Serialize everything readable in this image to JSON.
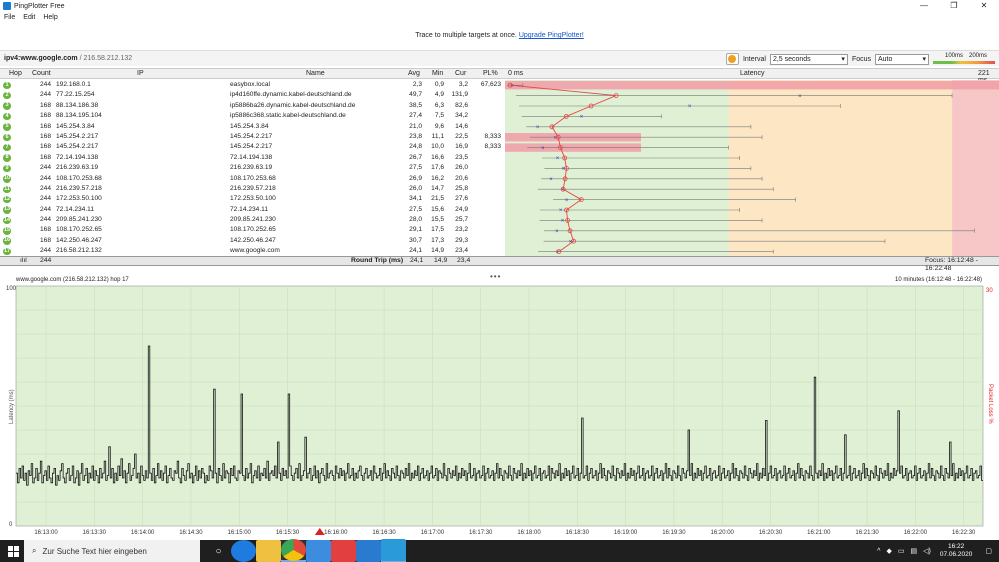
{
  "window": {
    "title": "PingPlotter Free",
    "minimize": "—",
    "maximize": "❐",
    "close": "✕"
  },
  "menu": [
    "File",
    "Edit",
    "Help"
  ],
  "banner": {
    "text": "Trace to multiple targets at once.",
    "link": "Upgrade PingPlotter!"
  },
  "target": {
    "prefix": "ipv4:",
    "host": "www.google.com",
    "ip": "/ 216.58.212.132"
  },
  "toolbar": {
    "interval_label": "Interval",
    "interval_value": "2,5 seconds",
    "focus_label": "Focus",
    "focus_value": "Auto",
    "scale_100": "100ms",
    "scale_200": "200ms"
  },
  "columns": {
    "hop": "Hop",
    "count": "Count",
    "ip": "IP",
    "name": "Name",
    "avg": "Avg",
    "min": "Min",
    "cur": "Cur",
    "pl": "PL%",
    "zero": "0 ms",
    "latency": "Latency",
    "max": "221 ms"
  },
  "hops": [
    {
      "hop": "1",
      "count": "244",
      "ip": "192.168.0.1",
      "name": "easybox.local",
      "avg": "2,3",
      "min": "0,9",
      "cur": "3,2",
      "pl": "67,623"
    },
    {
      "hop": "2",
      "count": "244",
      "ip": "77.22.15.254",
      "name": "ip4d160ffe.dynamic.kabel-deutschland.de",
      "avg": "49,7",
      "min": "4,9",
      "cur": "131,9",
      "pl": ""
    },
    {
      "hop": "3",
      "count": "168",
      "ip": "88.134.186.38",
      "name": "ip5886ba26.dynamic.kabel-deutschland.de",
      "avg": "38,5",
      "min": "6,3",
      "cur": "82,6",
      "pl": ""
    },
    {
      "hop": "4",
      "count": "168",
      "ip": "88.134.195.104",
      "name": "ip5886c368.static.kabel-deutschland.de",
      "avg": "27,4",
      "min": "7,5",
      "cur": "34,2",
      "pl": ""
    },
    {
      "hop": "5",
      "count": "168",
      "ip": "145.254.3.84",
      "name": "145.254.3.84",
      "avg": "21,0",
      "min": "9,6",
      "cur": "14,6",
      "pl": ""
    },
    {
      "hop": "6",
      "count": "168",
      "ip": "145.254.2.217",
      "name": "145.254.2.217",
      "avg": "23,8",
      "min": "11,1",
      "cur": "22,5",
      "pl": "8,333"
    },
    {
      "hop": "7",
      "count": "168",
      "ip": "145.254.2.217",
      "name": "145.254.2.217",
      "avg": "24,8",
      "min": "10,0",
      "cur": "16,9",
      "pl": "8,333"
    },
    {
      "hop": "8",
      "count": "168",
      "ip": "72.14.194.138",
      "name": "72.14.194.138",
      "avg": "26,7",
      "min": "16,6",
      "cur": "23,5",
      "pl": ""
    },
    {
      "hop": "9",
      "count": "244",
      "ip": "216.239.63.19",
      "name": "216.239.63.19",
      "avg": "27,5",
      "min": "17,6",
      "cur": "26,0",
      "pl": ""
    },
    {
      "hop": "10",
      "count": "244",
      "ip": "108.170.253.68",
      "name": "108.170.253.68",
      "avg": "26,9",
      "min": "16,2",
      "cur": "20,6",
      "pl": ""
    },
    {
      "hop": "11",
      "count": "244",
      "ip": "216.239.57.218",
      "name": "216.239.57.218",
      "avg": "26,0",
      "min": "14,7",
      "cur": "25,8",
      "pl": ""
    },
    {
      "hop": "12",
      "count": "244",
      "ip": "172.253.50.100",
      "name": "172.253.50.100",
      "avg": "34,1",
      "min": "21,5",
      "cur": "27,6",
      "pl": ""
    },
    {
      "hop": "13",
      "count": "244",
      "ip": "72.14.234.11",
      "name": "72.14.234.11",
      "avg": "27,5",
      "min": "15,6",
      "cur": "24,9",
      "pl": ""
    },
    {
      "hop": "14",
      "count": "244",
      "ip": "209.85.241.230",
      "name": "209.85.241.230",
      "avg": "28,0",
      "min": "15,5",
      "cur": "25,7",
      "pl": ""
    },
    {
      "hop": "15",
      "count": "168",
      "ip": "108.170.252.65",
      "name": "108.170.252.65",
      "avg": "29,1",
      "min": "17,5",
      "cur": "23,2",
      "pl": ""
    },
    {
      "hop": "16",
      "count": "168",
      "ip": "142.250.46.247",
      "name": "142.250.46.247",
      "avg": "30,7",
      "min": "17,3",
      "cur": "29,3",
      "pl": ""
    },
    {
      "hop": "17",
      "count": "244",
      "ip": "216.58.212.132",
      "name": "www.google.com",
      "avg": "24,1",
      "min": "14,9",
      "cur": "23,4",
      "pl": ""
    }
  ],
  "summary": {
    "count": "244",
    "label": "Round Trip (ms)",
    "avg": "24,1",
    "min": "14,9",
    "cur": "23,4",
    "focus": "Focus: 16:12:48 - 16:22:48"
  },
  "graph": {
    "title": "www.google.com (216.58.212.132) hop 17",
    "range": "10 minutes (16:12:48 - 16:22:48)",
    "ylabel": "Latency (ms)",
    "y2label": "Packet Loss %",
    "y_top": "100",
    "y_bottom": "0",
    "y2_top": "30",
    "xticks": [
      "16:13:00",
      "16:13:30",
      "16:14:00",
      "16:14:30",
      "16:15:00",
      "16:15:30",
      "16:16:00",
      "16:16:30",
      "16:17:00",
      "16:17:30",
      "16:18:00",
      "16:18:30",
      "16:19:00",
      "16:19:30",
      "16:20:00",
      "16:20:30",
      "16:21:00",
      "16:21:30",
      "16:22:00",
      "16:22:30"
    ]
  },
  "chart_data": {
    "type": "line",
    "title": "www.google.com (216.58.212.132) hop 17",
    "ylabel": "Latency (ms)",
    "ylim": [
      0,
      100
    ],
    "x_range": [
      "16:12:48",
      "16:22:48"
    ],
    "series": [
      {
        "values": [
          22,
          18,
          24,
          20,
          25,
          19,
          22,
          17,
          23,
          21,
          26,
          18,
          20,
          24,
          19,
          22,
          27,
          18,
          21,
          23,
          19,
          25,
          20,
          18,
          22,
          24,
          17,
          21,
          19,
          23,
          26,
          20,
          18,
          22,
          24,
          19,
          21,
          25,
          18,
          20,
          23,
          17,
          22,
          26,
          19,
          21,
          24,
          18,
          22,
          20,
          25,
          19,
          23,
          21,
          18,
          24,
          20,
          22,
          27,
          19,
          21,
          33,
          20,
          24,
          18,
          22,
          19,
          25,
          21,
          28,
          20,
          23,
          18,
          22,
          26,
          19,
          21,
          24,
          30,
          20,
          22,
          18,
          25,
          21,
          19,
          23,
          20,
          75,
          22,
          19,
          24,
          18,
          21,
          26,
          20,
          23,
          19,
          22,
          25,
          18,
          21,
          24,
          20,
          19,
          23,
          22,
          27,
          20,
          18,
          24,
          21,
          19,
          23,
          26,
          20,
          22,
          18,
          21,
          25,
          19,
          23,
          20,
          24,
          22,
          18,
          21,
          19,
          25,
          23,
          20,
          57,
          22,
          18,
          24,
          21,
          19,
          26,
          20,
          23,
          22,
          18,
          24,
          21,
          25,
          20,
          19,
          23,
          22,
          55,
          21,
          19,
          24,
          20,
          22,
          26,
          18,
          21,
          23,
          20,
          25,
          19,
          22,
          21,
          24,
          20,
          27,
          19,
          22,
          23,
          21,
          25,
          20,
          35,
          22,
          19,
          24,
          21,
          23,
          20,
          55,
          25,
          21,
          19,
          22,
          24,
          20,
          26,
          19,
          21,
          23,
          37,
          20,
          22,
          24,
          19,
          21,
          25,
          20,
          23,
          18,
          22,
          24,
          21,
          19,
          26,
          20,
          22,
          23,
          21,
          19,
          25,
          22,
          20,
          24,
          21,
          23,
          19,
          22,
          26,
          20,
          21,
          24,
          19,
          22,
          20,
          23,
          25,
          21,
          19,
          22,
          24,
          20,
          21,
          23,
          19,
          25,
          22,
          20,
          21,
          24,
          19,
          22,
          26,
          20,
          23,
          21,
          19,
          24,
          22,
          20,
          25,
          21,
          19,
          23,
          22,
          20,
          24,
          21,
          26,
          19,
          22,
          20,
          23,
          21,
          25,
          19,
          22,
          24,
          20,
          21,
          23,
          19,
          22,
          25,
          20,
          21,
          24,
          19,
          23,
          22,
          20,
          26,
          21,
          19,
          24,
          22,
          20,
          23,
          21,
          25,
          19,
          22,
          20,
          24,
          21,
          23,
          19,
          22,
          26,
          20,
          21,
          24,
          19,
          22,
          23,
          20,
          21,
          25,
          19,
          22,
          24,
          20,
          21,
          23,
          19,
          22,
          26,
          20,
          24,
          21,
          19,
          23,
          22,
          20,
          25,
          21,
          19,
          24,
          22,
          20,
          23,
          21,
          26,
          19,
          22,
          20,
          24,
          21,
          23,
          19,
          22,
          25,
          20,
          21,
          24,
          19,
          22,
          23,
          20,
          21,
          25,
          19,
          24,
          22,
          20,
          23,
          21,
          26,
          19,
          22,
          20,
          24,
          21,
          23,
          19,
          22,
          25,
          20,
          21,
          24,
          19,
          22,
          45,
          20,
          21,
          25,
          19,
          22,
          24,
          20,
          21,
          23,
          19,
          22,
          26,
          20,
          24,
          21,
          19,
          23,
          22,
          20,
          25,
          21,
          19,
          24,
          22,
          20,
          23,
          21,
          26,
          19,
          22,
          20,
          24,
          21,
          23,
          19,
          22,
          25,
          20,
          21,
          24,
          19,
          22,
          23,
          20,
          21,
          25,
          19,
          22,
          24,
          20,
          21,
          23,
          19,
          22,
          26,
          20,
          24,
          21,
          19,
          23,
          22,
          20,
          25,
          21,
          19,
          24,
          22,
          20,
          23,
          40,
          21,
          26,
          19,
          22,
          20,
          24,
          21,
          23,
          19,
          22,
          25,
          20,
          21,
          24,
          19,
          22,
          23,
          20,
          21,
          25,
          19,
          22,
          24,
          20,
          21,
          23,
          19,
          22,
          26,
          20,
          24,
          21,
          19,
          23,
          22,
          20,
          25,
          21,
          19,
          24,
          22,
          20,
          23,
          21,
          26,
          19,
          22,
          20,
          24,
          21,
          44,
          19,
          22,
          25,
          20,
          21,
          24,
          19,
          22,
          23,
          20,
          21,
          25,
          19,
          22,
          24,
          20,
          21,
          23,
          19,
          22,
          26,
          20,
          24,
          21,
          19,
          23,
          22,
          20,
          25,
          21,
          19,
          62,
          22,
          20,
          23,
          21,
          26,
          19,
          22,
          20,
          24,
          21,
          23,
          19,
          22,
          25,
          20,
          21,
          24,
          19,
          22,
          38,
          20,
          21,
          25,
          19,
          22,
          24,
          20,
          21,
          23,
          19,
          22,
          26,
          20,
          24,
          21,
          19,
          23,
          22,
          20,
          25,
          21,
          19,
          24,
          22,
          20,
          23,
          21,
          26,
          19,
          22,
          20,
          24,
          21,
          23,
          48,
          22,
          25,
          20,
          21,
          24,
          19,
          22,
          23,
          20,
          21,
          25,
          19,
          22,
          24,
          20,
          21,
          23,
          19,
          22,
          26,
          20,
          24,
          21,
          19,
          23,
          22,
          20,
          25,
          21,
          19,
          24,
          22,
          20,
          35,
          21,
          26,
          19,
          22,
          20,
          24,
          21,
          23,
          19,
          22,
          25,
          20,
          21,
          24,
          19,
          22,
          23,
          20,
          21,
          25,
          19
        ]
      }
    ],
    "packet_loss_marker": "16:16:00",
    "hop_latency": [
      {
        "hop": 1,
        "min": 0.9,
        "avg": 2.3,
        "cur": 3.2,
        "max": 8
      },
      {
        "hop": 2,
        "min": 4.9,
        "avg": 49.7,
        "cur": 131.9,
        "max": 200
      },
      {
        "hop": 3,
        "min": 6.3,
        "avg": 38.5,
        "cur": 82.6,
        "max": 150
      },
      {
        "hop": 4,
        "min": 7.5,
        "avg": 27.4,
        "cur": 34.2,
        "max": 70
      },
      {
        "hop": 5,
        "min": 9.6,
        "avg": 21.0,
        "cur": 14.6,
        "max": 110
      },
      {
        "hop": 6,
        "min": 11.1,
        "avg": 23.8,
        "cur": 22.5,
        "max": 115
      },
      {
        "hop": 7,
        "min": 10.0,
        "avg": 24.8,
        "cur": 16.9,
        "max": 100
      },
      {
        "hop": 8,
        "min": 16.6,
        "avg": 26.7,
        "cur": 23.5,
        "max": 105
      },
      {
        "hop": 9,
        "min": 17.6,
        "avg": 27.5,
        "cur": 26.0,
        "max": 110
      },
      {
        "hop": 10,
        "min": 16.2,
        "avg": 26.9,
        "cur": 20.6,
        "max": 115
      },
      {
        "hop": 11,
        "min": 14.7,
        "avg": 26.0,
        "cur": 25.8,
        "max": 120
      },
      {
        "hop": 12,
        "min": 21.5,
        "avg": 34.1,
        "cur": 27.6,
        "max": 130
      },
      {
        "hop": 13,
        "min": 15.6,
        "avg": 27.5,
        "cur": 24.9,
        "max": 105
      },
      {
        "hop": 14,
        "min": 15.5,
        "avg": 28.0,
        "cur": 25.7,
        "max": 115
      },
      {
        "hop": 15,
        "min": 17.5,
        "avg": 29.1,
        "cur": 23.2,
        "max": 210
      },
      {
        "hop": 16,
        "min": 17.3,
        "avg": 30.7,
        "cur": 29.3,
        "max": 170
      },
      {
        "hop": 17,
        "min": 14.9,
        "avg": 24.1,
        "cur": 23.4,
        "max": 120
      }
    ],
    "latency_axis": [
      0,
      221
    ],
    "colors": {
      "good": "#6cb33f",
      "warn": "#f7c25a",
      "bad": "#f08080",
      "line": "#e24848",
      "grid_bg": "#dff0d4"
    }
  },
  "taskbar": {
    "search_placeholder": "Zur Suche Text hier eingeben",
    "time": "16:22",
    "date": "07.06.2020",
    "icons": [
      "task-view-icon",
      "edge-icon",
      "explorer-icon",
      "chrome-icon",
      "store-icon",
      "gift-icon",
      "mail-icon",
      "pingplotter-icon"
    ]
  }
}
